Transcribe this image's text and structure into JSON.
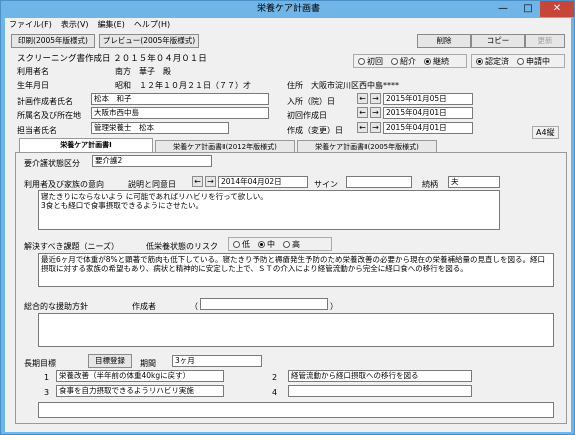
{
  "window": {
    "title": "栄養ケア計画書",
    "min": "—",
    "max": "□",
    "close": "✕"
  },
  "menu": [
    "ファイル(F)",
    "表示(V)",
    "編集(E)",
    "ヘルプ(H)"
  ],
  "toolbar": {
    "print": "印刷(2005年版様式)",
    "preview": "プレビュー(2005年版様式)",
    "delete": "削除",
    "copy": "コピー",
    "update": "更新"
  },
  "header": {
    "screening": "スクリーニング書作成日 ２０１５年０４月０１日",
    "user_label": "利用者名",
    "user_name": "南方　華子　殿",
    "birth_label": "生年月日",
    "birth_value": "昭和　１２年１０月２１日（７７）才",
    "address_label": "住所",
    "address_value": "大阪市淀川区西中島****",
    "a4": "A4縦"
  },
  "mode_group": {
    "options": [
      "初回",
      "紹介",
      "継続"
    ],
    "selected": 2
  },
  "status_group": {
    "options": [
      "認定済",
      "申請中"
    ],
    "selected": 0
  },
  "form": {
    "planner_label": "計画作成者氏名",
    "planner_value": "松本　和子",
    "facility_label": "所属名及び所在地",
    "facility_value": "大阪市西中島",
    "dietitian_label": "担当者氏名",
    "dietitian_value": "管理栄養士　松本",
    "admit_label": "入所（院）日",
    "admit_value": "2015年01月05日",
    "first_label": "初回作成日",
    "first_value": "2015年04月01日",
    "made_label": "作成（変更）日",
    "made_value": "2015年04月01日"
  },
  "tabs": [
    "栄養ケア計画書Ⅰ",
    "栄養ケア計画書Ⅱ(2012年版様式)",
    "栄養ケア計画書Ⅱ(2005年版様式)"
  ],
  "panel": {
    "care_level_label": "要介護状態区分",
    "care_level_value": "要介護2",
    "intent_label": "利用者及び家族の意向",
    "consent_label": "説明と同意日",
    "consent_date": "2014年04月02日",
    "sign_label": "サイン",
    "sign_value": "",
    "relation_label": "続柄",
    "relation_value": "夫",
    "intent_text": "寝たきりにならないよう に可能であればリハビリを行って欲しい。\n3食とも経口で食事摂取できるようにさせたい。",
    "issue_label": "解決すべき課題（ニーズ）",
    "risk_label": "低栄養状態のリスク",
    "risk_options": [
      "低",
      "中",
      "高"
    ],
    "risk_selected": 1,
    "issue_text": "最近6ヶ月で体重が8%と顕著で筋肉も低下している。寝たきり予防と褥瘡発生予防のため栄養改善の必要から現在の栄養補給量の見直しを図る。経口摂取に対する家族の希望もあり、病状と精神的に安定した上で、ＳＴの介入により経管流動から完全に経口食への移行を図る。",
    "policy_label": "総合的な援助方針",
    "author_label": "作成者",
    "paren_open": "（",
    "paren_close": "）",
    "author_value": "",
    "policy_text": "",
    "goal_label": "長期目標",
    "goal_button": "目標登録",
    "period_label": "期間",
    "period_value": "3ヶ月",
    "goals": [
      {
        "num": "1",
        "text": "栄養改善（半年前の体重40kgに戻す）"
      },
      {
        "num": "2",
        "text": "経管流動から経口摂取への移行を図る"
      },
      {
        "num": "3",
        "text": "食事を自力摂取できるようリハビリ実施"
      },
      {
        "num": "4",
        "text": ""
      }
    ],
    "remarks": ""
  },
  "arrows": {
    "left": "←",
    "right": "→"
  }
}
